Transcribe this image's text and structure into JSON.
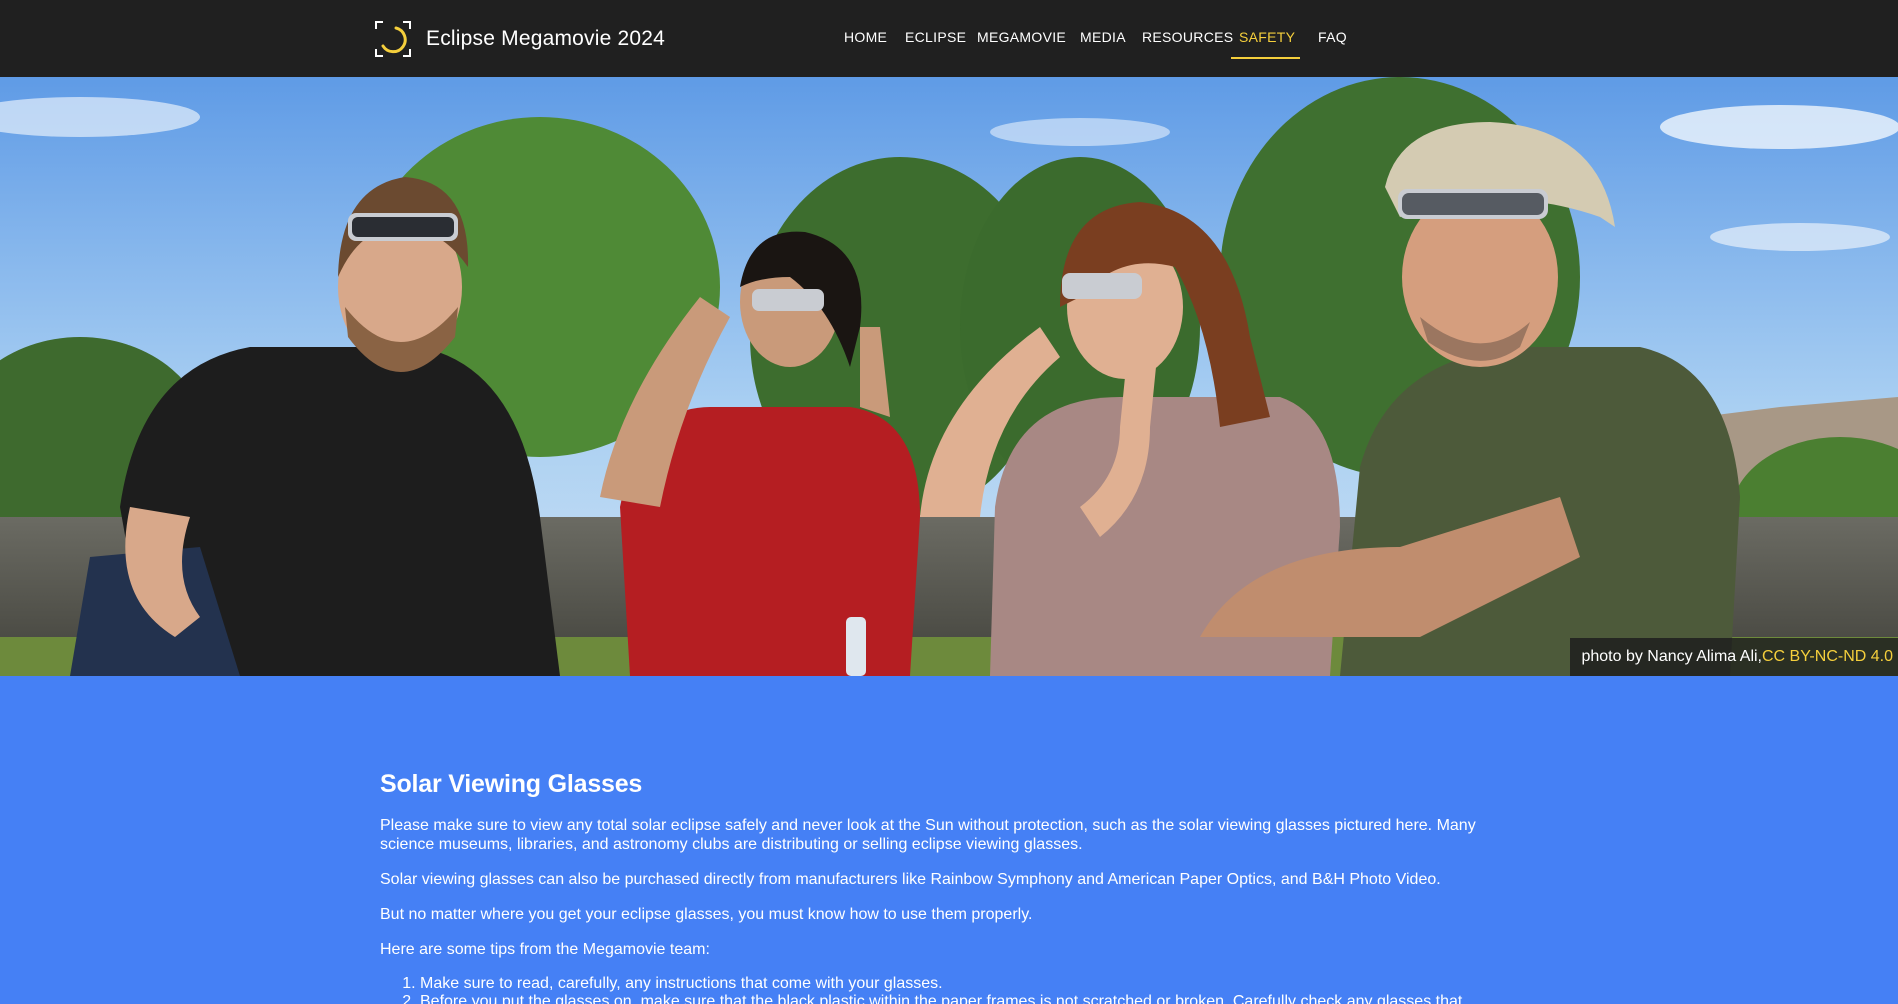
{
  "header": {
    "brand": "Eclipse Megamovie 2024",
    "nav": [
      {
        "label": "HOME",
        "active": false
      },
      {
        "label": "ECLIPSE",
        "active": false
      },
      {
        "label": "MEGAMOVIE",
        "active": false
      },
      {
        "label": "MEDIA",
        "active": false
      },
      {
        "label": "RESOURCES",
        "active": false
      },
      {
        "label": "SAFETY",
        "active": true
      },
      {
        "label": "FAQ",
        "active": false
      }
    ]
  },
  "hero": {
    "credit_text": "photo by Nancy Alima Ali, ",
    "credit_license": "CC BY-NC-ND 4.0"
  },
  "content": {
    "title": "Solar Viewing Glasses",
    "paragraphs": [
      "Please make sure to view any total solar eclipse safely and never look at the Sun without protection, such as the solar viewing glasses pictured here. Many science museums, libraries, and astronomy clubs are distributing or selling eclipse viewing glasses.",
      "Solar viewing glasses can also be purchased directly from manufacturers like Rainbow Symphony and American Paper Optics, and B&H Photo Video.",
      "But no matter where you get your eclipse glasses, you must know how to use them properly.",
      "Here are some tips from the Megamovie team:"
    ],
    "tips": [
      "Make sure to read, carefully, any instructions that come with your glasses.",
      "Before you put the glasses on, make sure that the black plastic within the paper frames is not scratched or broken. Carefully check any glasses that children"
    ]
  },
  "colors": {
    "header_bg": "#202020",
    "accent": "#f5cf3c",
    "page_bg": "#4580f5",
    "text": "#ffffff"
  },
  "icons": [
    "eclipse-logo-icon"
  ]
}
